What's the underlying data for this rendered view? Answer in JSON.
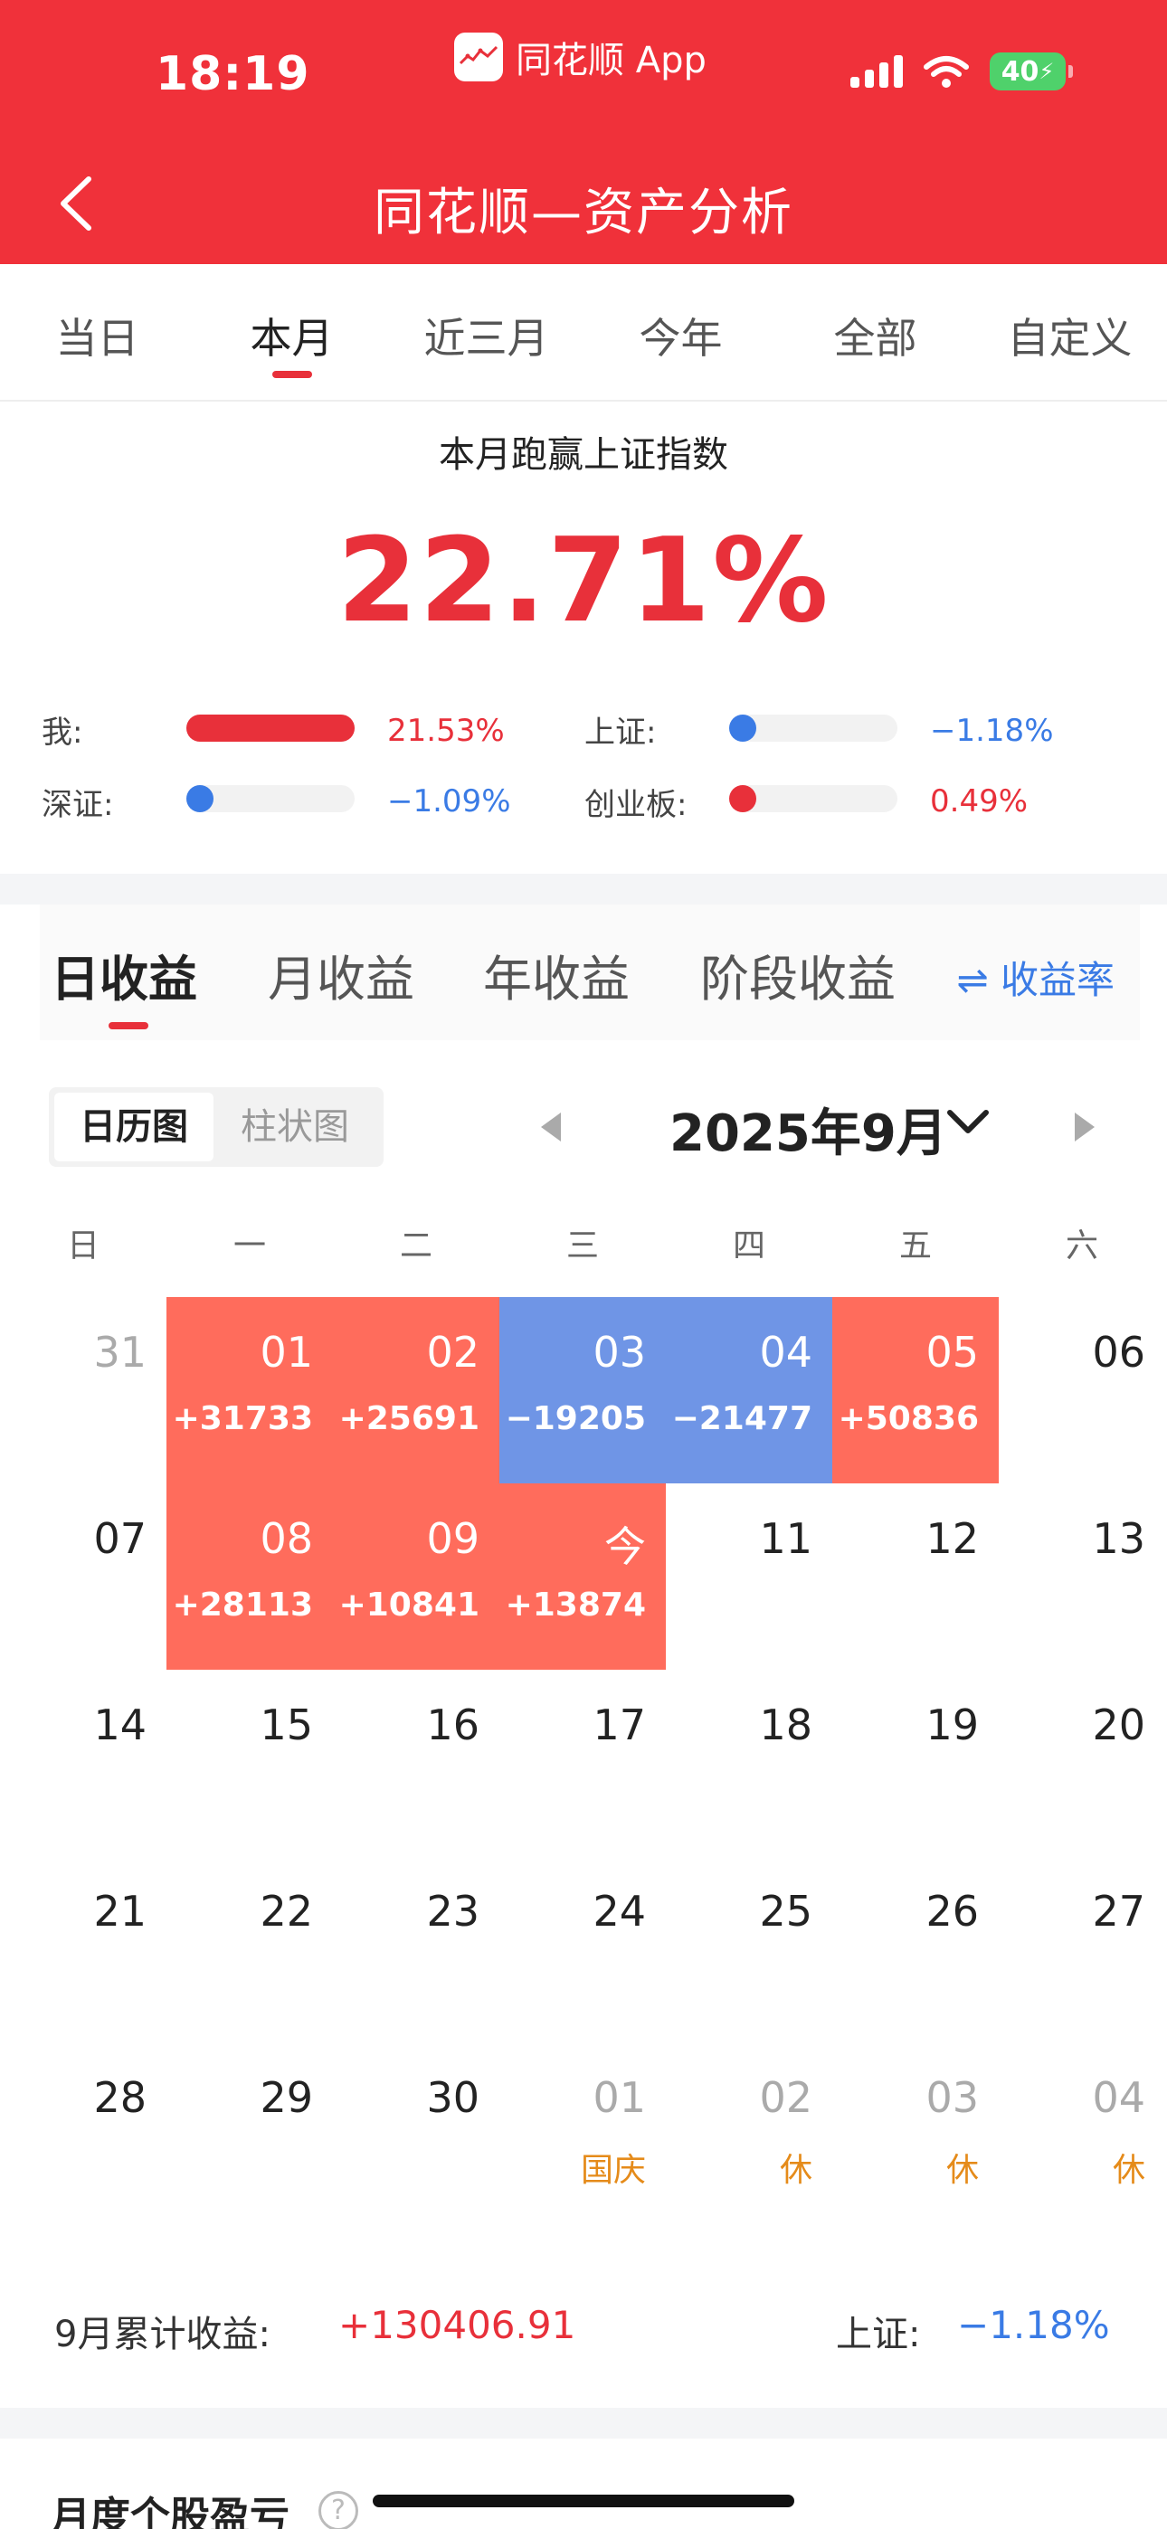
{
  "status_bar": {
    "time": "18:19",
    "app_name": "同花顺 App",
    "battery": "40"
  },
  "nav": {
    "title": "同花顺—资产分析"
  },
  "range_tabs": [
    "当日",
    "本月",
    "近三月",
    "今年",
    "全部",
    "自定义"
  ],
  "summary": {
    "title": "本月跑赢上证指数",
    "value": "22.71%",
    "comparisons": [
      {
        "label": "我:",
        "value": "21.53%",
        "fraction": 1.0,
        "color": "#e8303a"
      },
      {
        "label": "上证:",
        "value": "−1.18%",
        "fraction": 0.0,
        "color": "#3a7be5"
      },
      {
        "label": "深证:",
        "value": "−1.09%",
        "fraction": 0.0,
        "color": "#3a7be5"
      },
      {
        "label": "创业板:",
        "value": "0.49%",
        "fraction": 0.0,
        "color": "#e8303a"
      }
    ]
  },
  "earn_tabs": [
    "日收益",
    "月收益",
    "年收益",
    "阶段收益"
  ],
  "rate_switch": "⇌ 收益率",
  "view_toggle": {
    "calendar": "日历图",
    "bar": "柱状图"
  },
  "month_label": "2025年9月",
  "weekdays": [
    "日",
    "一",
    "二",
    "三",
    "四",
    "五",
    "六"
  ],
  "calendar": [
    [
      {
        "d": "31",
        "m": true
      },
      {
        "d": "01",
        "v": "+31733",
        "t": "up"
      },
      {
        "d": "02",
        "v": "+25691",
        "t": "up"
      },
      {
        "d": "03",
        "v": "−19205",
        "t": "down"
      },
      {
        "d": "04",
        "v": "−21477",
        "t": "down"
      },
      {
        "d": "05",
        "v": "+50836",
        "t": "up"
      },
      {
        "d": "06"
      }
    ],
    [
      {
        "d": "07"
      },
      {
        "d": "08",
        "v": "+28113",
        "t": "up"
      },
      {
        "d": "09",
        "v": "+10841",
        "t": "up"
      },
      {
        "d": "今",
        "v": "+13874",
        "t": "up"
      },
      {
        "d": "11"
      },
      {
        "d": "12"
      },
      {
        "d": "13"
      }
    ],
    [
      {
        "d": "14"
      },
      {
        "d": "15"
      },
      {
        "d": "16"
      },
      {
        "d": "17"
      },
      {
        "d": "18"
      },
      {
        "d": "19"
      },
      {
        "d": "20"
      }
    ],
    [
      {
        "d": "21"
      },
      {
        "d": "22"
      },
      {
        "d": "23"
      },
      {
        "d": "24"
      },
      {
        "d": "25"
      },
      {
        "d": "26"
      },
      {
        "d": "27"
      }
    ],
    [
      {
        "d": "28"
      },
      {
        "d": "29"
      },
      {
        "d": "30"
      },
      {
        "d": "01",
        "m": true,
        "h": "国庆"
      },
      {
        "d": "02",
        "m": true,
        "h": "休"
      },
      {
        "d": "03",
        "m": true,
        "h": "休"
      },
      {
        "d": "04",
        "m": true,
        "h": "休"
      }
    ]
  ],
  "totals": {
    "label": "9月累计收益:",
    "value": "+130406.91",
    "index_label": "上证:",
    "index_value": "−1.18%"
  },
  "bottom_section": {
    "title": "月度个股盈亏",
    "help": "?"
  }
}
